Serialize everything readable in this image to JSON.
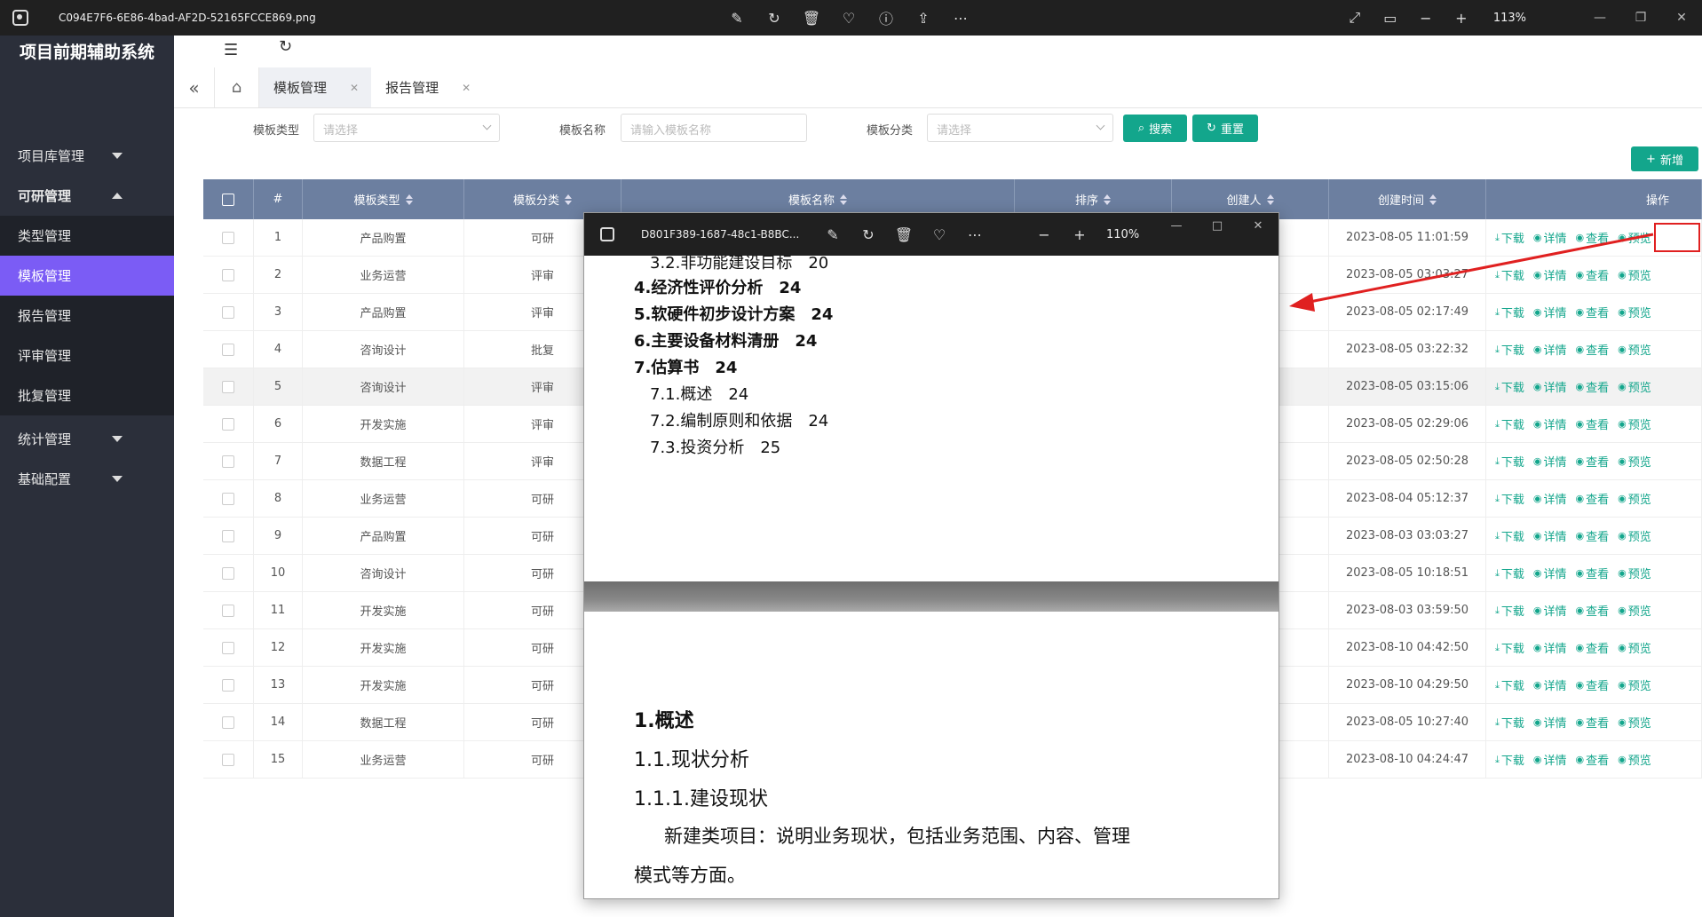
{
  "viewer": {
    "file_name": "C094E7F6-6E86-4bad-AF2D-52165FCCE869.png",
    "zoom": "113%"
  },
  "sidebar": {
    "title": "项目前期辅助系统",
    "groups": [
      {
        "label": "项目库管理"
      },
      {
        "label": "可研管理"
      },
      {
        "label": "统计管理"
      },
      {
        "label": "基础配置"
      }
    ],
    "subitems": [
      {
        "label": "类型管理"
      },
      {
        "label": "模板管理"
      },
      {
        "label": "报告管理"
      },
      {
        "label": "评审管理"
      },
      {
        "label": "批复管理"
      }
    ]
  },
  "tabs": [
    {
      "label": "模板管理"
    },
    {
      "label": "报告管理"
    }
  ],
  "filters": {
    "type_label": "模板类型",
    "type_placeholder": "请选择",
    "name_label": "模板名称",
    "name_placeholder": "请输入模板名称",
    "category_label": "模板分类",
    "category_placeholder": "请选择",
    "search_label": "搜索",
    "reset_label": "重置",
    "add_label": "新增"
  },
  "table": {
    "headers": {
      "index": "#",
      "type": "模板类型",
      "category": "模板分类",
      "name": "模板名称",
      "order": "排序",
      "creator": "创建人",
      "created": "创建时间",
      "ops": "操作"
    },
    "action_labels": {
      "download": "下载",
      "detail": "详情",
      "view": "查看",
      "preview": "预览"
    },
    "rows": [
      {
        "idx": "1",
        "type": "产品购置",
        "cat": "可研",
        "time": "2023-08-05 11:01:59"
      },
      {
        "idx": "2",
        "type": "业务运营",
        "cat": "评审",
        "time": "2023-08-05 03:03:27"
      },
      {
        "idx": "3",
        "type": "产品购置",
        "cat": "评审",
        "time": "2023-08-05 02:17:49"
      },
      {
        "idx": "4",
        "type": "咨询设计",
        "cat": "批复",
        "time": "2023-08-05 03:22:32"
      },
      {
        "idx": "5",
        "type": "咨询设计",
        "cat": "评审",
        "time": "2023-08-05 03:15:06"
      },
      {
        "idx": "6",
        "type": "开发实施",
        "cat": "评审",
        "time": "2023-08-05 02:29:06"
      },
      {
        "idx": "7",
        "type": "数据工程",
        "cat": "评审",
        "time": "2023-08-05 02:50:28"
      },
      {
        "idx": "8",
        "type": "业务运营",
        "cat": "可研",
        "time": "2023-08-04 05:12:37"
      },
      {
        "idx": "9",
        "type": "产品购置",
        "cat": "可研",
        "time": "2023-08-03 03:03:27"
      },
      {
        "idx": "10",
        "type": "咨询设计",
        "cat": "可研",
        "time": "2023-08-05 10:18:51"
      },
      {
        "idx": "11",
        "type": "开发实施",
        "cat": "可研",
        "time": "2023-08-03 03:59:50"
      },
      {
        "idx": "12",
        "type": "开发实施",
        "cat": "可研",
        "time": "2023-08-10 04:42:50"
      },
      {
        "idx": "13",
        "type": "开发实施",
        "cat": "可研",
        "time": "2023-08-10 04:29:50"
      },
      {
        "idx": "14",
        "type": "数据工程",
        "cat": "可研",
        "time": "2023-08-05 10:27:40"
      },
      {
        "idx": "15",
        "type": "业务运营",
        "cat": "可研",
        "time": "2023-08-10 04:24:47"
      }
    ]
  },
  "pdf": {
    "file_name": "D801F389-1687-48c1-B8BC...",
    "zoom": "110%",
    "toc": [
      {
        "text": "3.2.非功能建设目标　20",
        "bold": false
      },
      {
        "text": "4.经济性评价分析　24",
        "bold": true
      },
      {
        "text": "5.软硬件初步设计方案　24",
        "bold": true
      },
      {
        "text": "6.主要设备材料清册　24",
        "bold": true
      },
      {
        "text": "7.估算书　24",
        "bold": true
      },
      {
        "text": "7.1.概述　24",
        "bold": false
      },
      {
        "text": "7.2.编制原则和依据　24",
        "bold": false
      },
      {
        "text": "7.3.投资分析　25",
        "bold": false
      }
    ],
    "body": {
      "h1": "1.概述",
      "h2": "1.1.现状分析",
      "h3": "1.1.1.建设现状",
      "p1": "新建类项目：说明业务现状，包括业务范围、内容、管理",
      "p2": "模式等方面。"
    }
  },
  "colors": {
    "accent": "#13a68c",
    "sidebar": "#2b2f3a",
    "active": "#7b5cf5",
    "header": "#6c7fa0",
    "annotation": "#e02020"
  }
}
